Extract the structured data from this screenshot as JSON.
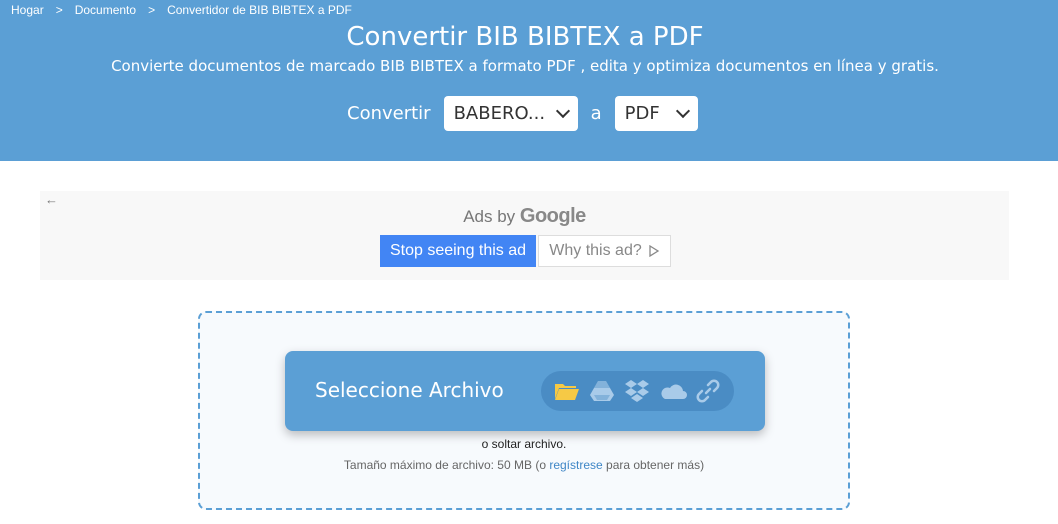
{
  "breadcrumb": {
    "items": [
      "Hogar",
      "Documento",
      "Convertidor de BIB BIBTEX a PDF"
    ],
    "separator": ">"
  },
  "hero": {
    "title": "Convertir BIB BIBTEX a PDF",
    "subtitle": "Convierte documentos de marcado BIB BIBTEX a formato PDF , edita y optimiza documentos en línea y gratis.",
    "convert_label": "Convertir",
    "from_value": "BABERO...",
    "connector": "a",
    "to_value": "PDF"
  },
  "ad": {
    "back_glyph": "←",
    "ads_by": "Ads by",
    "google": "Google",
    "stop_label": "Stop seeing this ad",
    "why_label": "Why this ad?"
  },
  "upload": {
    "select_label": "Seleccione Archivo",
    "sources": [
      "folder-icon",
      "google-drive-icon",
      "dropbox-icon",
      "onedrive-icon",
      "link-icon"
    ],
    "drop_text": "o soltar archivo.",
    "limit_prefix": "Tamaño máximo de archivo: 50 MB (o ",
    "limit_link": "regístrese",
    "limit_suffix": " para obtener más)"
  },
  "colors": {
    "hero_bg": "#5b9fd5",
    "google_blue": "#4285f4",
    "folder_yellow": "#f6c945"
  }
}
